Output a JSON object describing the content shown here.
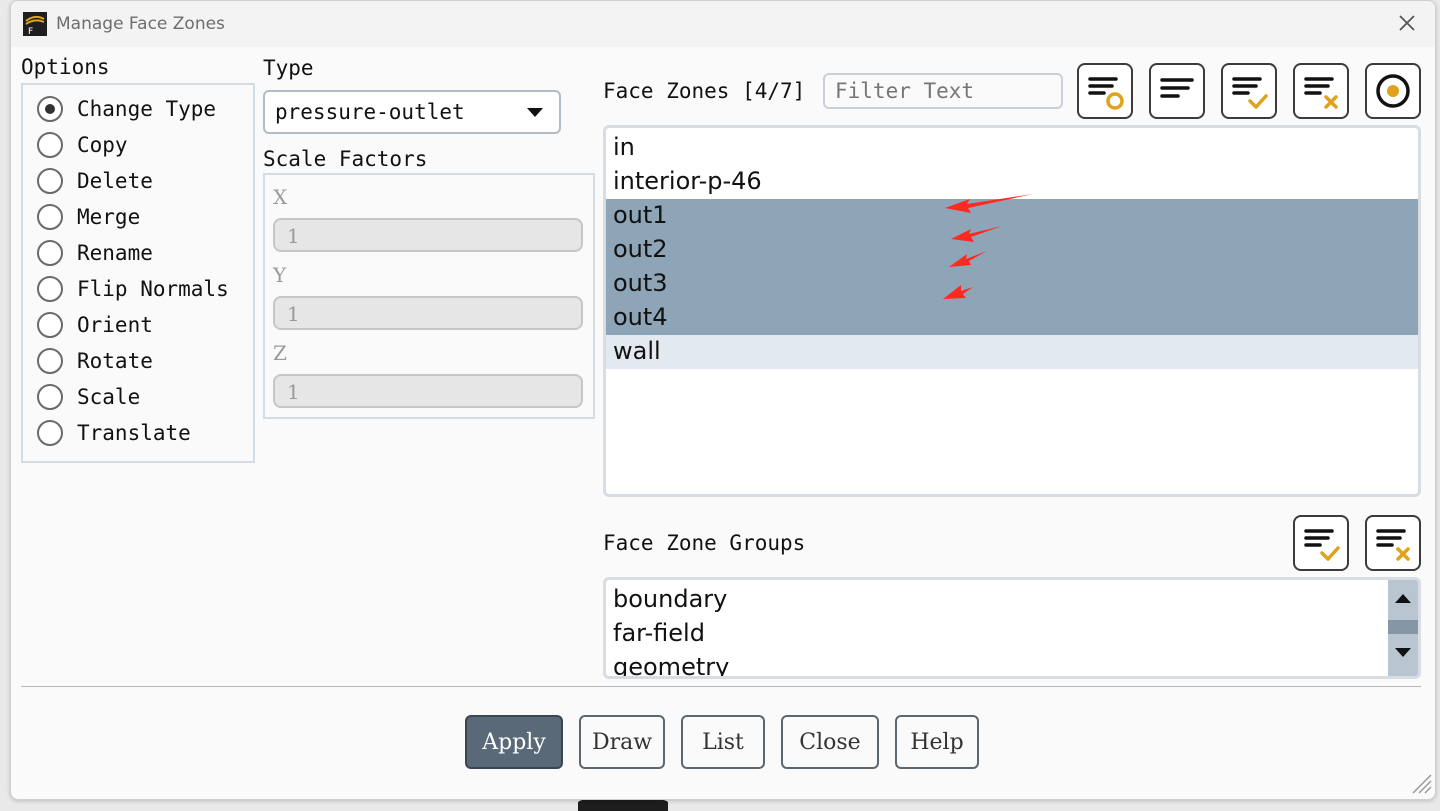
{
  "window": {
    "title": "Manage Face Zones"
  },
  "options": {
    "heading": "Options",
    "items": [
      {
        "label": "Change Type",
        "checked": true
      },
      {
        "label": "Copy",
        "checked": false
      },
      {
        "label": "Delete",
        "checked": false
      },
      {
        "label": "Merge",
        "checked": false
      },
      {
        "label": "Rename",
        "checked": false
      },
      {
        "label": "Flip Normals",
        "checked": false
      },
      {
        "label": "Orient",
        "checked": false
      },
      {
        "label": "Rotate",
        "checked": false
      },
      {
        "label": "Scale",
        "checked": false
      },
      {
        "label": "Translate",
        "checked": false
      }
    ]
  },
  "type": {
    "heading": "Type",
    "selected": "pressure-outlet"
  },
  "scale_factors": {
    "heading": "Scale Factors",
    "x_label": "X",
    "x_value": "1",
    "y_label": "Y",
    "y_value": "1",
    "z_label": "Z",
    "z_value": "1"
  },
  "face_zones": {
    "heading": "Face Zones [4/7]",
    "filter_placeholder": "Filter Text",
    "items": [
      {
        "label": "in",
        "state": "normal"
      },
      {
        "label": "interior-p-46",
        "state": "normal"
      },
      {
        "label": "out1",
        "state": "selected"
      },
      {
        "label": "out2",
        "state": "selected"
      },
      {
        "label": "out3",
        "state": "selected"
      },
      {
        "label": "out4",
        "state": "selected"
      },
      {
        "label": "wall",
        "state": "hover"
      }
    ]
  },
  "face_zone_groups": {
    "heading": "Face Zone Groups",
    "items": [
      "boundary",
      "far-field",
      "geometry"
    ]
  },
  "buttons": {
    "apply": "Apply",
    "draw": "Draw",
    "list": "List",
    "close": "Close",
    "help": "Help"
  },
  "colors": {
    "selected_row": "#8ea4b7",
    "hover_row": "#e3e9f0",
    "primary_button": "#5a6978",
    "icon_accent": "#e0a21b",
    "annotation_arrow": "#ff2a1f"
  }
}
